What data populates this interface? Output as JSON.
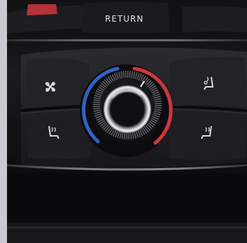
{
  "photo": {
    "label_return": "RETURN",
    "accent_red": "#d1363d",
    "accent_blue": "#2f63c6"
  }
}
